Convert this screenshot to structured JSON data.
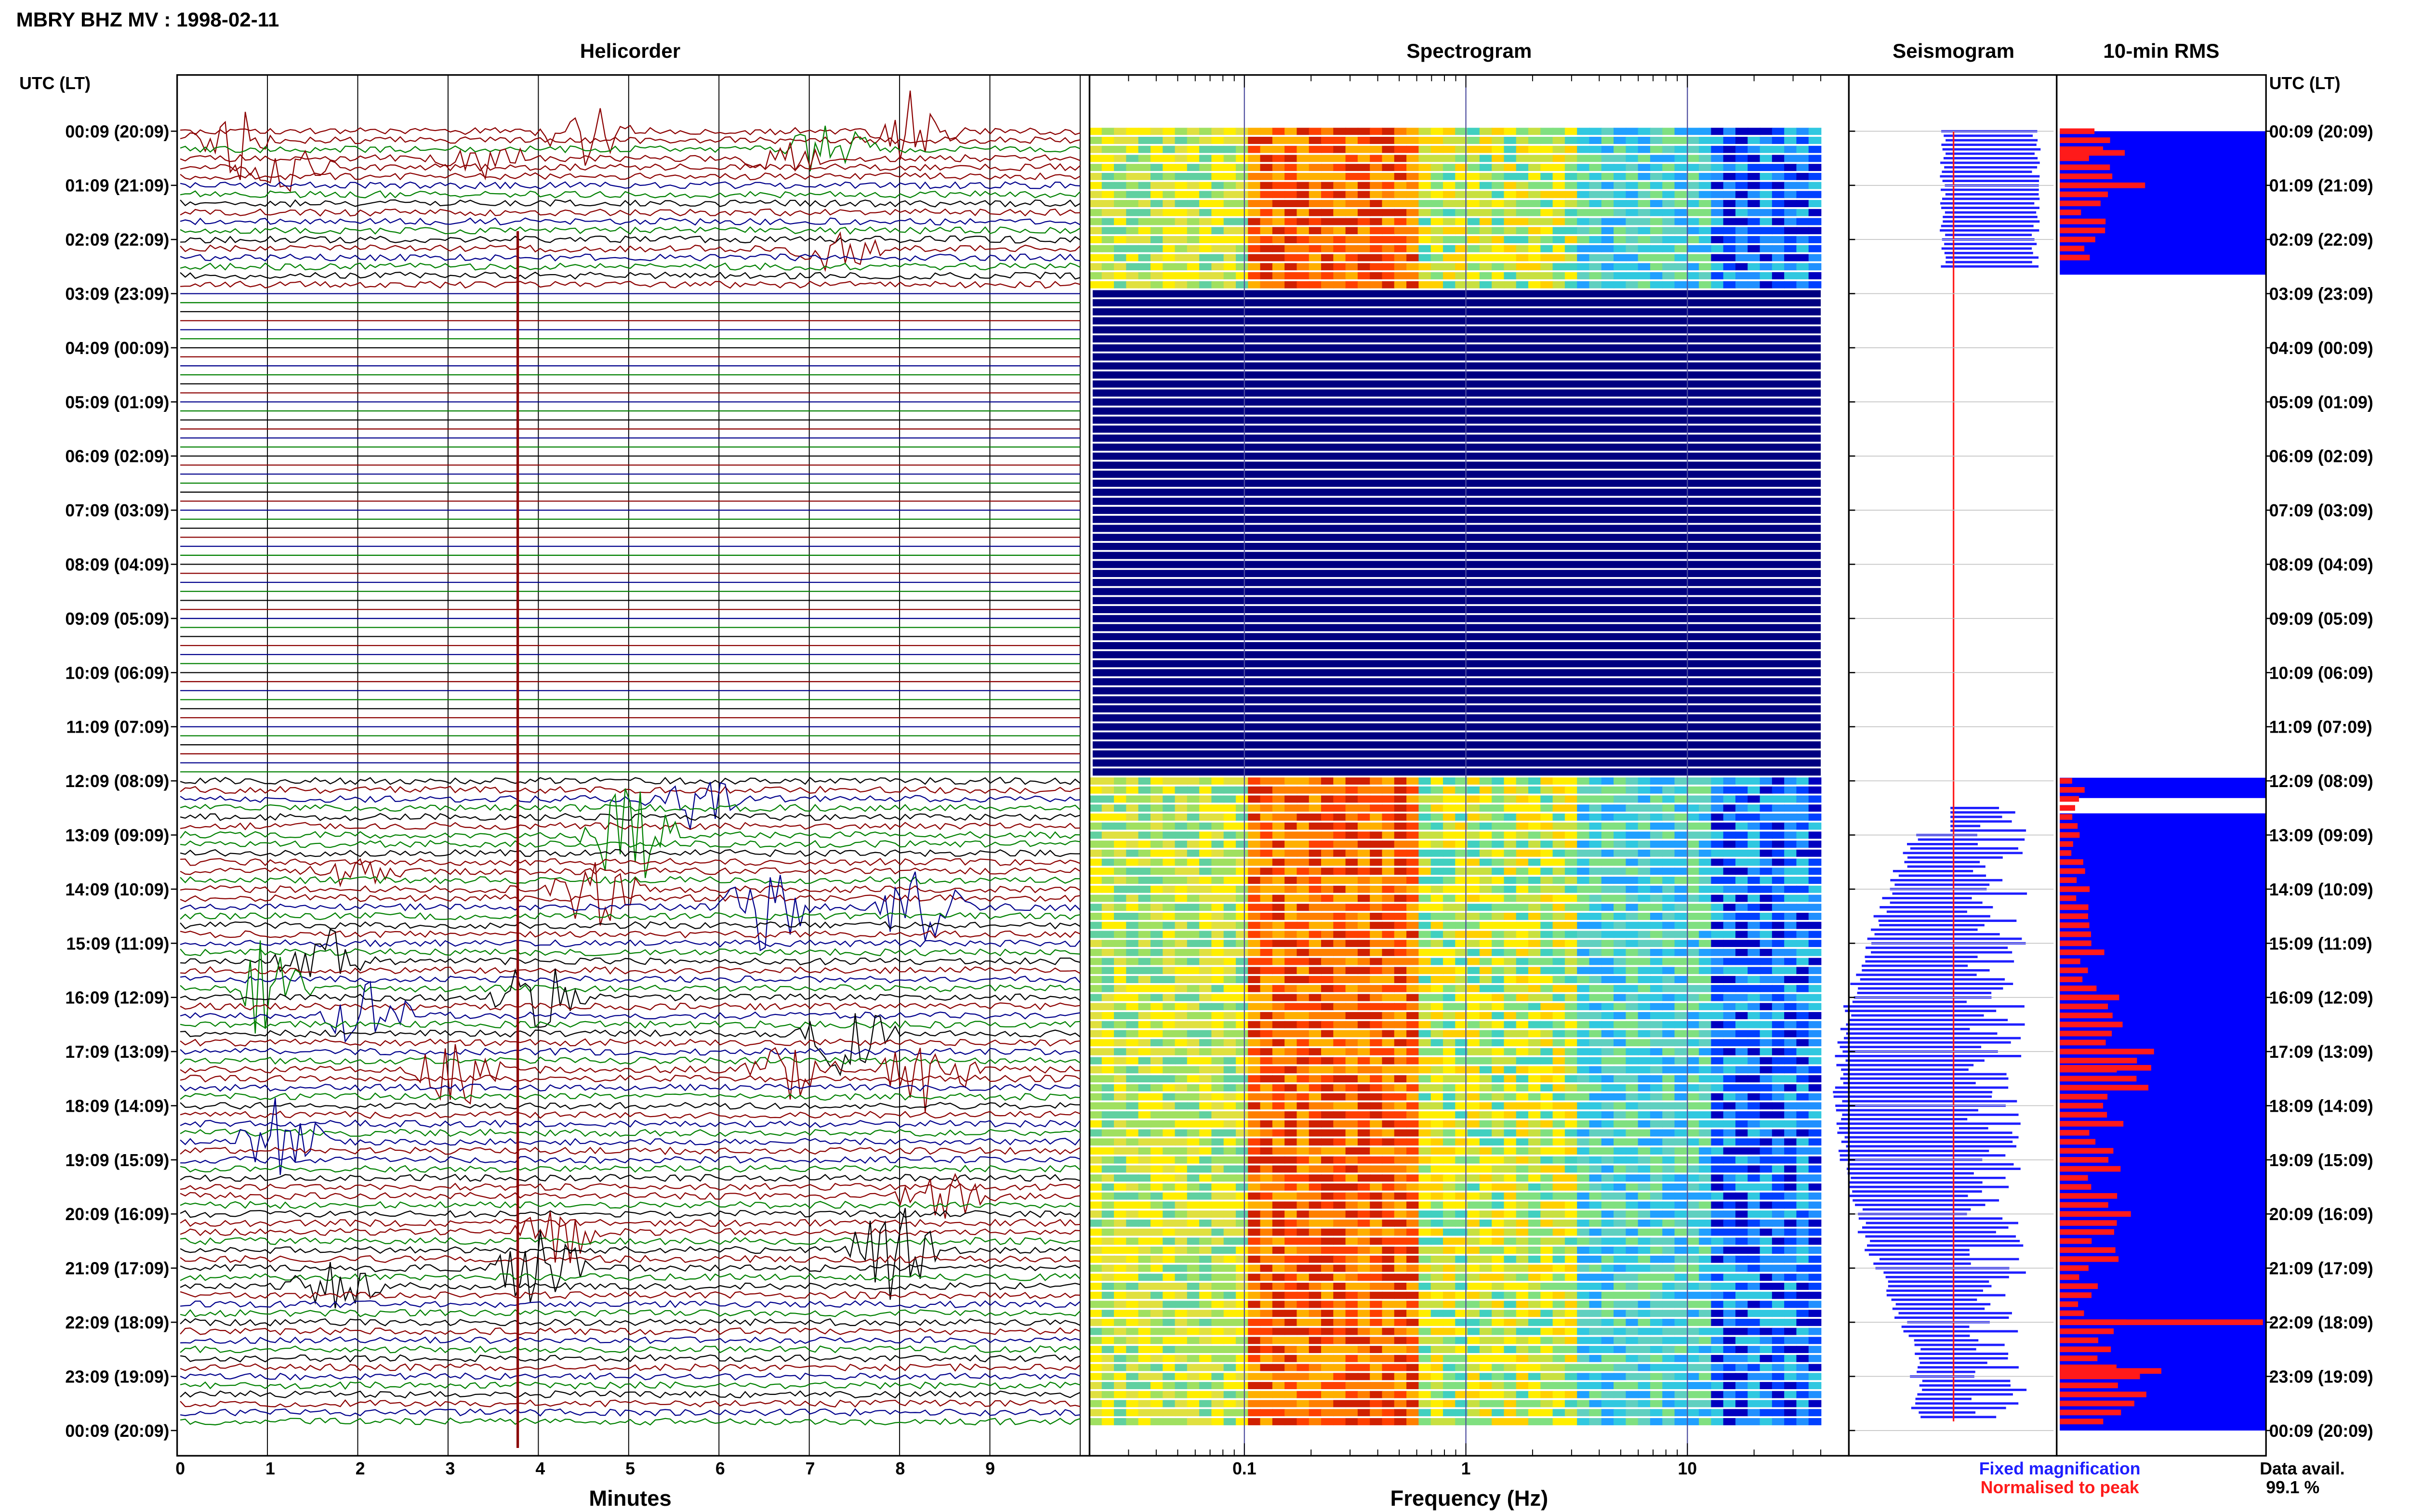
{
  "page_title": "MBRY BHZ MV : 1998-02-11",
  "panels": {
    "helicorder": "Helicorder",
    "spectrogram": "Spectrogram",
    "seismogram": "Seismogram",
    "rms": "10-min RMS"
  },
  "axis_header_left": "UTC (LT)",
  "axis_header_right": "UTC (LT)",
  "time_labels": [
    "00:09 (20:09)",
    "01:09 (21:09)",
    "02:09 (22:09)",
    "03:09 (23:09)",
    "04:09 (00:09)",
    "05:09 (01:09)",
    "06:09 (02:09)",
    "07:09 (03:09)",
    "08:09 (04:09)",
    "09:09 (05:09)",
    "10:09 (06:09)",
    "11:09 (07:09)",
    "12:09 (08:09)",
    "13:09 (09:09)",
    "14:09 (10:09)",
    "15:09 (11:09)",
    "16:09 (12:09)",
    "17:09 (13:09)",
    "18:09 (14:09)",
    "19:09 (15:09)",
    "20:09 (16:09)",
    "21:09 (17:09)",
    "22:09 (18:09)",
    "23:09 (19:09)",
    "00:09 (20:09)"
  ],
  "helicorder_xlabel": "Minutes",
  "helicorder_ticks": [
    "0",
    "1",
    "2",
    "3",
    "4",
    "5",
    "6",
    "7",
    "8",
    "9"
  ],
  "spectrogram_xlabel": "Frequency (Hz)",
  "spectrogram_ticks": [
    "0.1",
    "1",
    "10"
  ],
  "legend": {
    "fixed": "Fixed magnification",
    "normalised": "Normalised to peak",
    "fixed_color": "#1f1fff",
    "normalised_color": "#ff1a1a"
  },
  "data_avail_label": "Data avail.",
  "data_avail_value": "99.1 %",
  "chart_data": [
    {
      "type": "line",
      "name": "helicorder",
      "title": "Helicorder",
      "xlabel": "Minutes",
      "xlim": [
        0,
        10
      ],
      "rows_per_hour": 6,
      "trace_colors": [
        "#000000",
        "#8b0000",
        "#00008b",
        "#008000"
      ],
      "rows": 144,
      "data_gap_hours": [
        3,
        12
      ]
    },
    {
      "type": "heatmap",
      "name": "spectrogram",
      "title": "Spectrogram",
      "xlabel": "Frequency (Hz)",
      "xscale": "log",
      "xlim": [
        0.02,
        40
      ],
      "no_data_color": "#000080",
      "peak_band_hz": [
        0.15,
        0.5
      ]
    },
    {
      "type": "bar",
      "name": "rms",
      "title": "10-min RMS",
      "categories": [
        "00:09",
        "01:09",
        "02:09",
        "03:09",
        "04:09",
        "05:09",
        "06:09",
        "07:09",
        "08:09",
        "09:09",
        "10:09",
        "11:09",
        "12:09",
        "13:09",
        "14:09",
        "15:09",
        "16:09",
        "17:09",
        "18:09",
        "19:09",
        "20:09",
        "21:09",
        "22:09",
        "23:09"
      ],
      "values": [
        0.25,
        0.22,
        0.18,
        0,
        0,
        0,
        0,
        0,
        0,
        0,
        0,
        0,
        0.12,
        0.12,
        0.15,
        0.2,
        0.28,
        0.42,
        0.3,
        0.28,
        0.3,
        0.18,
        0.35,
        0.4
      ],
      "spike_values": [
        0.32,
        0.12,
        0.12,
        0.1,
        0.14,
        0.18,
        0.3,
        0.4,
        0.28,
        0.3,
        0.42,
        0.3,
        1.0,
        0.5
      ]
    }
  ]
}
